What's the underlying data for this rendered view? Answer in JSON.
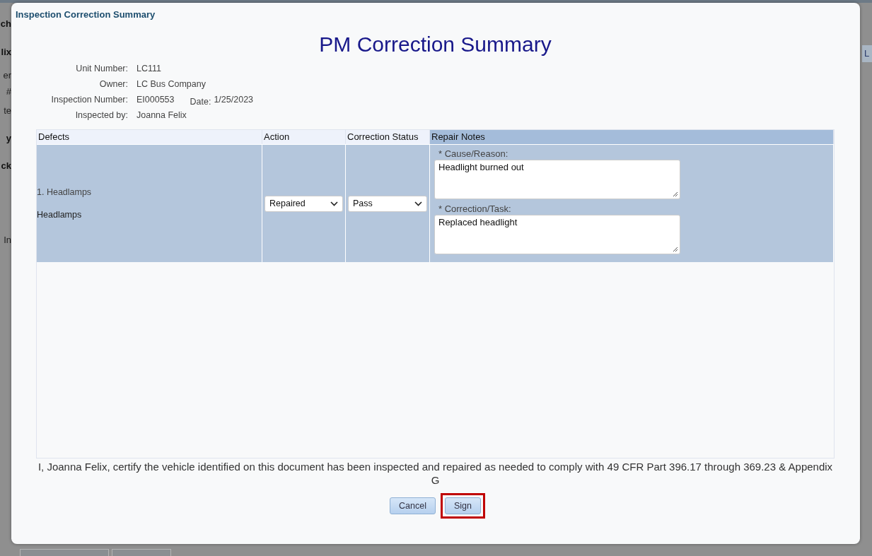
{
  "backdrop": {
    "left_fragments": [
      "ch",
      "lix",
      "er",
      "#",
      "te",
      "y",
      "ck",
      "In"
    ],
    "right_fragments": [
      "L"
    ]
  },
  "dialog": {
    "title": "Inspection Correction Summary",
    "heading": "PM Correction Summary",
    "info": [
      {
        "label": "Unit Number:",
        "value": "LC111"
      },
      {
        "label": "Owner:",
        "value": "LC Bus Company"
      },
      {
        "label": "Inspection Number:",
        "value": "EI000553",
        "extra_label": "Date:",
        "extra_value": "1/25/2023"
      },
      {
        "label": "Inspected by:",
        "value": "Joanna Felix"
      }
    ],
    "table": {
      "columns": [
        {
          "label": "Defects",
          "highlighted": false
        },
        {
          "label": "Action",
          "highlighted": false
        },
        {
          "label": "Correction Status",
          "highlighted": false
        },
        {
          "label": "Repair Notes",
          "highlighted": true
        }
      ],
      "rows": [
        {
          "defect_item": "1. Headlamps",
          "defect_name": "Headlamps",
          "action": "Repaired",
          "correction_status": "Pass",
          "notes": [
            {
              "label": "* Cause/Reason:",
              "value": "Headlight burned out"
            },
            {
              "label": "* Correction/Task:",
              "value": "Replaced headlight"
            }
          ]
        }
      ]
    },
    "certification": "I, Joanna Felix, certify the vehicle identified on this document has been inspected and repaired as needed to comply with 49 CFR Part 396.17 through 369.23 & Appendix G",
    "buttons": [
      {
        "label": "Cancel",
        "highlighted": false
      },
      {
        "label": "Sign",
        "highlighted": true
      }
    ]
  }
}
